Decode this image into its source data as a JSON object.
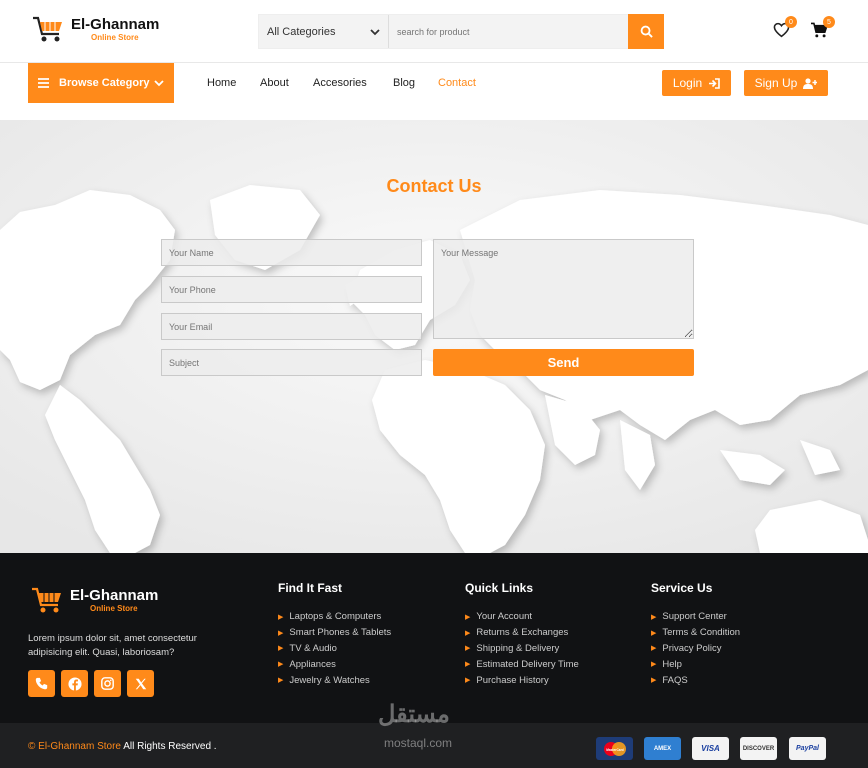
{
  "brand": {
    "name": "El-Ghannam",
    "tagline": "Online Store"
  },
  "search": {
    "category": "All Categories",
    "placeholder": "search for product"
  },
  "header": {
    "wishlist_count": "0",
    "cart_count": "5"
  },
  "nav": {
    "browse_label": "Browse Category",
    "links": [
      "Home",
      "About",
      "Accesories",
      "Blog",
      "Contact"
    ],
    "login": "Login",
    "signup": "Sign Up"
  },
  "contact": {
    "title": "Contact Us",
    "name_ph": "Your Name",
    "phone_ph": "Your Phone",
    "email_ph": "Your Email",
    "subject_ph": "Subject",
    "message_ph": "Your Message",
    "send": "Send"
  },
  "footer": {
    "description": "Lorem ipsum dolor sit, amet consectetur adipisicing elit. Quasi, laboriosam?",
    "columns": [
      {
        "title": "Find It Fast",
        "items": [
          "Laptops & Computers",
          "Smart Phones & Tablets",
          "TV & Audio",
          "Appliances",
          "Jewelry & Watches"
        ]
      },
      {
        "title": "Quick Links",
        "items": [
          "Your Account",
          "Returns & Exchanges",
          "Shipping & Delivery",
          "Estimated Delivery Time",
          "Purchase History"
        ]
      },
      {
        "title": "Service Us",
        "items": [
          "Support Center",
          "Terms & Condition",
          "Privacy Policy",
          "Help",
          "FAQS"
        ]
      }
    ],
    "copyright_symbol": "©",
    "copyright_brand": "El-Ghannam Store",
    "copyright_rest": "All Rights Reserved .",
    "payments": [
      "MasterCard",
      "AMEX",
      "VISA",
      "DISCOVER",
      "PayPal"
    ]
  },
  "watermark": {
    "arabic": "مستقل",
    "latin": "mostaql.com"
  },
  "colors": {
    "accent": "#ff8a1a",
    "footer_bg": "#111214",
    "bottom_bg": "#1f2022"
  }
}
